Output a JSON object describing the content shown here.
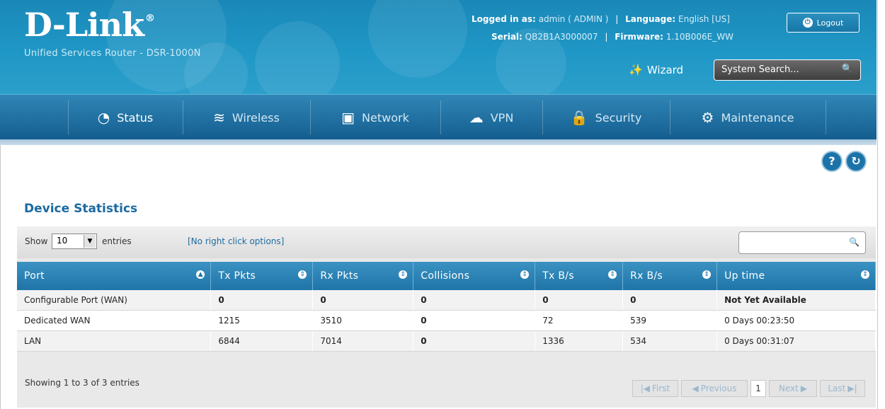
{
  "brand": {
    "logo": "D-Link",
    "reg": "®",
    "subtitle": "Unified Services Router - DSR-1000N"
  },
  "header": {
    "logged_label": "Logged in as:",
    "logged_value": "admin ( ADMIN )",
    "language_label": "Language:",
    "language_value": "English [US]",
    "serial_label": "Serial:",
    "serial_value": "QB2B1A3000007",
    "firmware_label": "Firmware:",
    "firmware_value": "1.10B006E_WW",
    "logout": "Logout",
    "wizard": "Wizard",
    "search_placeholder": "System Search..."
  },
  "nav": [
    {
      "label": "Status",
      "icon": "speedometer-icon"
    },
    {
      "label": "Wireless",
      "icon": "wifi-icon"
    },
    {
      "label": "Network",
      "icon": "monitor-icon"
    },
    {
      "label": "VPN",
      "icon": "cloud-lock-icon"
    },
    {
      "label": "Security",
      "icon": "lock-icon"
    },
    {
      "label": "Maintenance",
      "icon": "gears-icon"
    }
  ],
  "page": {
    "title": "Device Statistics",
    "help_icon": "?",
    "refresh_icon": "↻"
  },
  "toolbar": {
    "show": "Show",
    "entries_value": "10",
    "entries": "entries",
    "no_right_click": "[No right click options]"
  },
  "table": {
    "columns": [
      "Port",
      "Tx Pkts",
      "Rx Pkts",
      "Collisions",
      "Tx B/s",
      "Rx B/s",
      "Up time"
    ],
    "rows": [
      [
        "Configurable Port (WAN)",
        "0",
        "0",
        "0",
        "0",
        "0",
        "Not Yet Available"
      ],
      [
        "Dedicated WAN",
        "1215",
        "3510",
        "0",
        "72",
        "539",
        "0 Days 00:23:50"
      ],
      [
        "LAN",
        "6844",
        "7014",
        "0",
        "1336",
        "534",
        "0 Days 00:31:07"
      ]
    ]
  },
  "footer": {
    "info": "Showing 1 to 3 of 3 entries",
    "first": "First",
    "previous": "Previous",
    "page": "1",
    "next": "Next",
    "last": "Last"
  },
  "colors": {
    "header": "#1f97c6",
    "nav": "#1f6e9f",
    "accent": "#1b6aa0",
    "table_header": "#2a84b7"
  }
}
